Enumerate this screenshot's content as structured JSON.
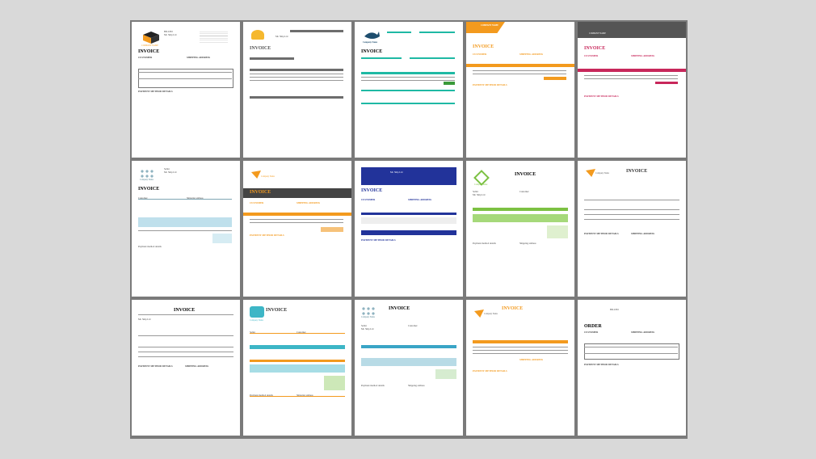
{
  "templates": [
    {
      "title": "INVOICE",
      "bill_from": "BILLED",
      "from_name": "Mr. Ship Ltd",
      "customer": "CUSTOMER",
      "shipping": "SHIPPING ADDRESS",
      "payment": "PAYMENT METHOD DETAILS",
      "logo_text": "COMPANY NAME",
      "accent": "#222222"
    },
    {
      "title": "INVOICE",
      "bill_from": "",
      "from_name": "Mr. Ship Ltd",
      "customer": "",
      "shipping": "",
      "payment": "",
      "logo_text": "",
      "accent": "#6d6d6d"
    },
    {
      "title": "INVOICE",
      "bill_from": "",
      "from_name": "",
      "customer": "",
      "shipping": "",
      "payment": "",
      "logo_text": "Company Name",
      "accent": "#1fb9a4"
    },
    {
      "title": "INVOICE",
      "bill_from": "",
      "from_name": "",
      "customer": "CUSTOMER",
      "shipping": "SHIPPING ADDRESS",
      "payment": "PAYMENT METHOD DETAILS",
      "logo_text": "COMPANY NAME",
      "accent": "#f39a1e"
    },
    {
      "title": "INVOICE",
      "bill_from": "",
      "from_name": "",
      "customer": "CUSTOMER",
      "shipping": "SHIPPING ADDRESS",
      "payment": "PAYMENT METHOD DETAILS",
      "logo_text": "COMPANY NAME",
      "accent": "#c8275b"
    },
    {
      "title": "INVOICE",
      "bill_from": "Seller",
      "from_name": "Mr. Ship Ltd",
      "customer": "Customer",
      "shipping": "Shipping address",
      "payment": "Payment method details",
      "logo_text": "Company Name",
      "accent": "#7fa6b4"
    },
    {
      "title": "INVOICE",
      "bill_from": "",
      "from_name": "",
      "customer": "CUSTOMER",
      "shipping": "SHIPPING ADDRESS",
      "payment": "PAYMENT METHOD DETAILS",
      "logo_text": "Company Name",
      "accent": "#f39a1e"
    },
    {
      "title": "INVOICE",
      "bill_from": "",
      "from_name": "Mr. Ship Ltd",
      "customer": "CUSTOMER",
      "shipping": "SHIPPING ADDRESS",
      "payment": "PAYMENT METHOD DETAILS",
      "logo_text": "",
      "accent": "#22339a"
    },
    {
      "title": "INVOICE",
      "bill_from": "Seller",
      "from_name": "Mr. Ship Ltd",
      "customer": "Customer",
      "shipping": "Shipping address",
      "payment": "Payment method details",
      "logo_text": "Company name",
      "accent": "#7cc142"
    },
    {
      "title": "INVOICE",
      "bill_from": "",
      "from_name": "",
      "customer": "",
      "shipping": "SHIPPING ADDRESS",
      "payment": "PAYMENT METHOD DETAILS",
      "logo_text": "Company Name",
      "accent": "#f39a1e"
    },
    {
      "title": "INVOICE",
      "bill_from": "",
      "from_name": "Mr. Ship Ltd",
      "customer": "",
      "shipping": "SHIPPING ADDRESS",
      "payment": "PAYMENT METHOD DETAILS",
      "logo_text": "",
      "accent": "#333333"
    },
    {
      "title": "INVOICE",
      "bill_from": "Seller",
      "from_name": "Mr. Ship Ltd",
      "customer": "Customer",
      "shipping": "Shipping address",
      "payment": "Payment method details",
      "logo_text": "Company Name",
      "accent": "#3db6c6"
    },
    {
      "title": "INVOICE",
      "bill_from": "Seller",
      "from_name": "Mr. Ship Ltd",
      "customer": "Customer",
      "shipping": "Shipping address",
      "payment": "Payment method details",
      "logo_text": "Company Name",
      "accent": "#3aa5c6"
    },
    {
      "title": "INVOICE",
      "bill_from": "",
      "from_name": "",
      "customer": "",
      "shipping": "SHIPPING ADDRESS",
      "payment": "PAYMENT METHOD DETAILS",
      "logo_text": "Company Name",
      "accent": "#f39a1e"
    },
    {
      "title": "ORDER",
      "bill_from": "BILLED",
      "from_name": "",
      "customer": "CUSTOMER",
      "shipping": "SHIPPING ADDRESS",
      "payment": "PAYMENT METHOD DETAILS",
      "logo_text": "",
      "accent": "#222222"
    }
  ]
}
